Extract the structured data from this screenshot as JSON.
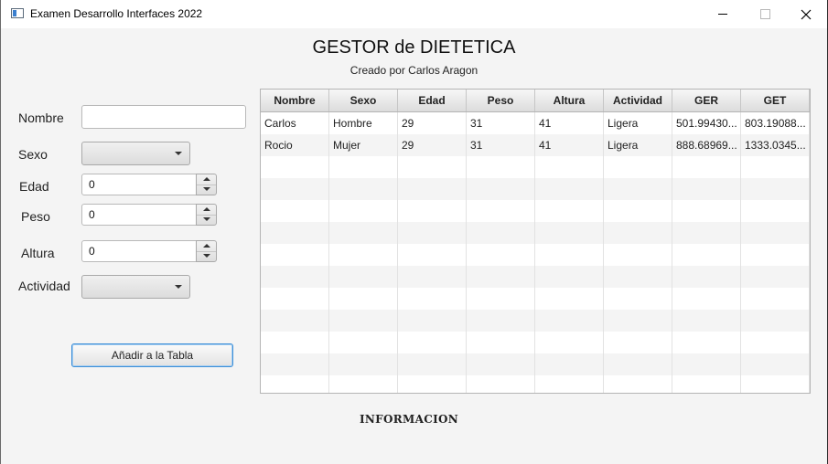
{
  "window": {
    "title": "Examen Desarrollo Interfaces 2022"
  },
  "header": {
    "title": "GESTOR de DIETETICA",
    "subtitle": "Creado por Carlos Aragon"
  },
  "form": {
    "nombre_label": "Nombre",
    "nombre_value": "",
    "sexo_label": "Sexo",
    "sexo_value": "",
    "edad_label": "Edad",
    "edad_value": "0",
    "peso_label": "Peso",
    "peso_value": "0",
    "altura_label": "Altura",
    "altura_value": "0",
    "actividad_label": "Actividad",
    "actividad_value": "",
    "add_button": "Añadir a la Tabla"
  },
  "table": {
    "columns": [
      "Nombre",
      "Sexo",
      "Edad",
      "Peso",
      "Altura",
      "Actividad",
      "GER",
      "GET"
    ],
    "rows": [
      [
        "Carlos",
        "Hombre",
        "29",
        "31",
        "41",
        "Ligera",
        "501.99430...",
        "803.19088..."
      ],
      [
        "Rocio",
        "Mujer",
        "29",
        "31",
        "41",
        "Ligera",
        "888.68969...",
        "1333.0345..."
      ]
    ]
  },
  "footer": {
    "info_label": "INFORMACION"
  }
}
